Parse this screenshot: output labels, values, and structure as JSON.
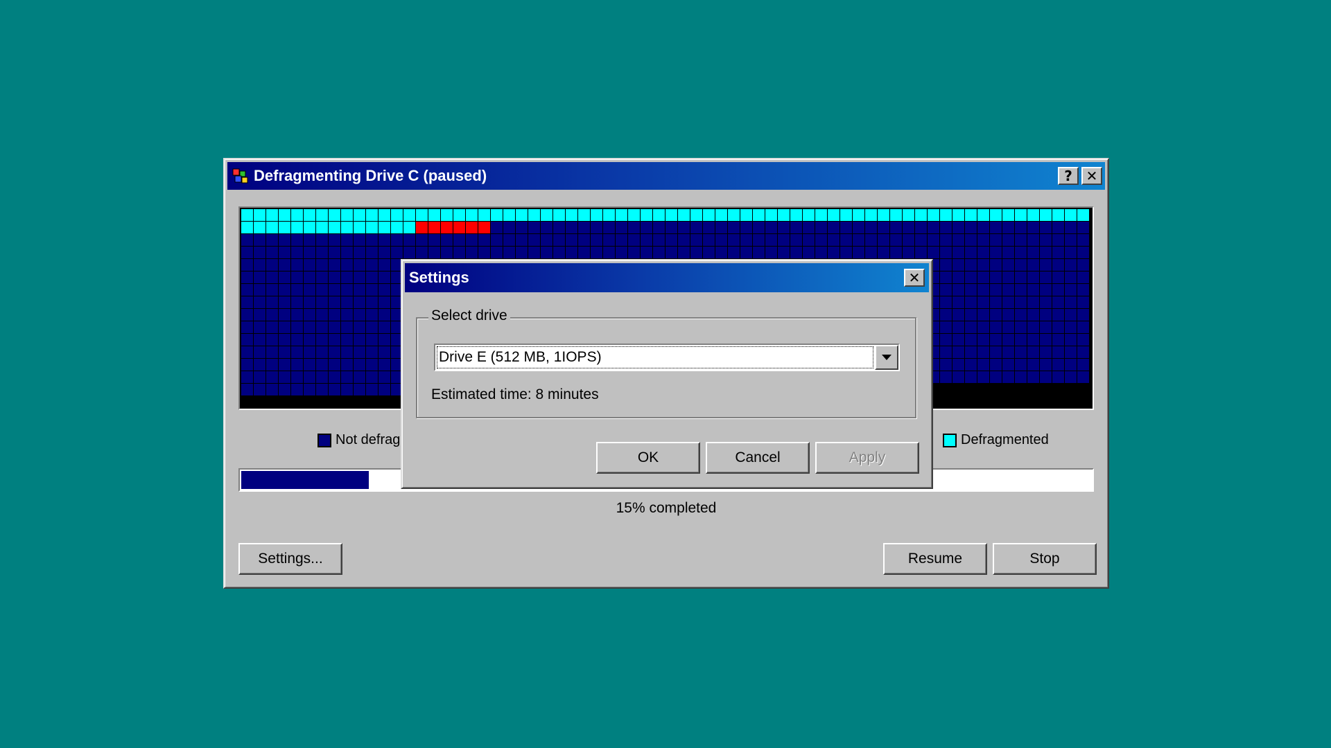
{
  "main_window": {
    "title": "Defragmenting Drive C (paused)",
    "help_label": "?",
    "close_label": "✕",
    "legend": [
      {
        "label": "Not defragmented",
        "color": "#000080"
      },
      {
        "label": "Defragmented",
        "color": "#00ffff"
      }
    ],
    "progress_fraction": 0.15,
    "status_text": "15% completed",
    "settings_button": "Settings...",
    "resume_button": "Resume",
    "stop_button": "Stop"
  },
  "disk_map": {
    "columns": 68,
    "rows": 15,
    "cells_defragmented": 82,
    "cells_active_start": 82,
    "cells_active_count": 6,
    "cells_total_used": 976,
    "colors": {
      "defragmented": "#00ffff",
      "active": "#ff0000",
      "not_defragmented": "#000080",
      "empty": "#000000"
    }
  },
  "settings_dialog": {
    "title": "Settings",
    "close_label": "✕",
    "group_label": "Select drive",
    "selected_drive": "Drive E (512 MB, 1IOPS)",
    "estimate_text": "Estimated time: 8 minutes",
    "ok_button": "OK",
    "cancel_button": "Cancel",
    "apply_button": "Apply"
  }
}
